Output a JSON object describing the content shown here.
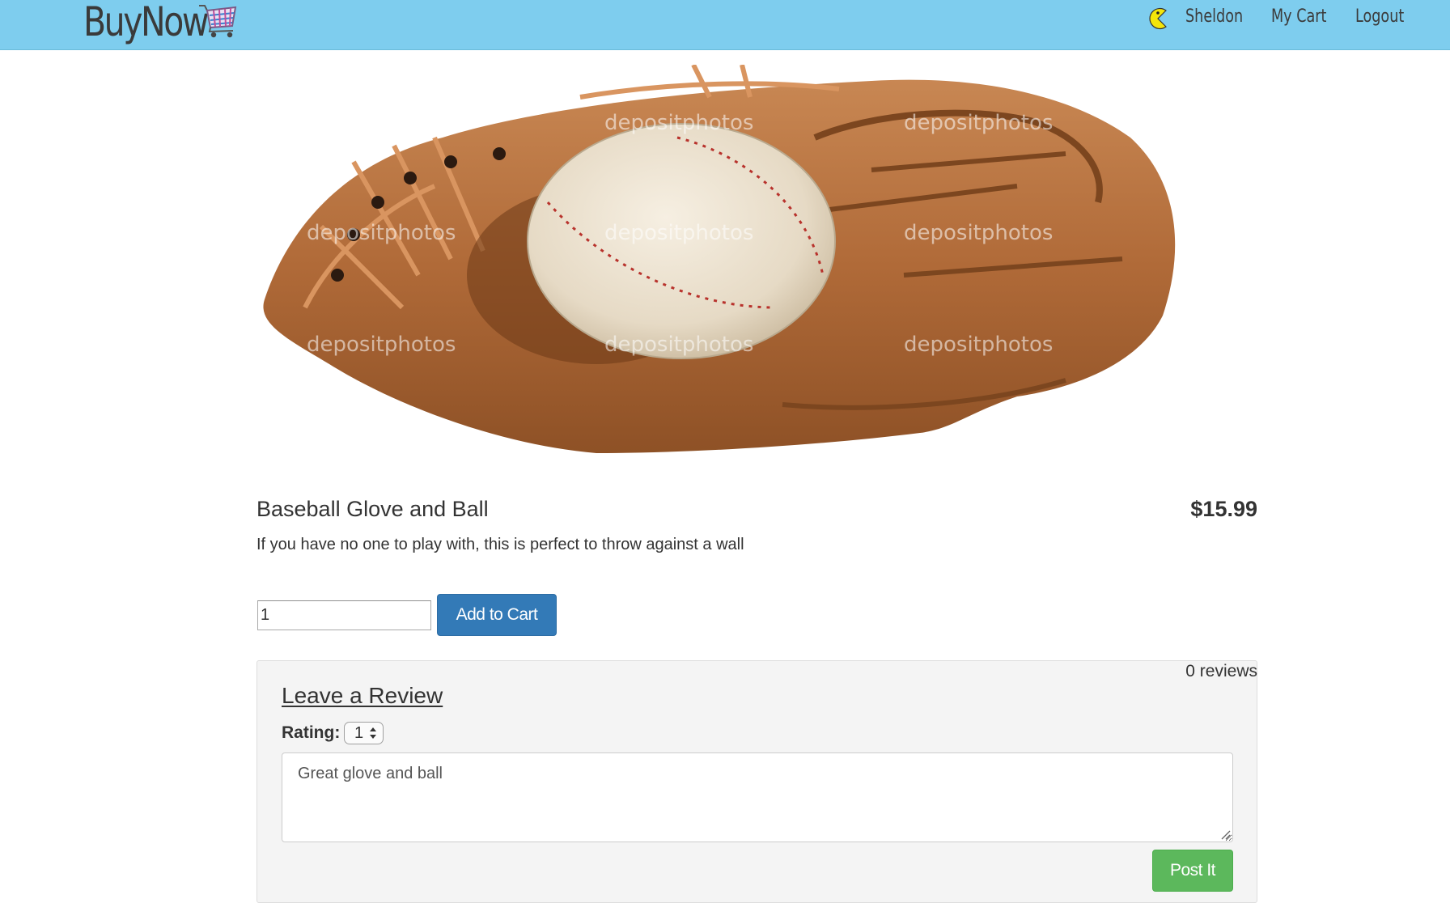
{
  "navbar": {
    "brand": "BuyNow",
    "brand_icon": "shopping-cart-icon",
    "user_icon": "pacman-icon",
    "user_name": "Sheldon",
    "cart_link": "My Cart",
    "logout_link": "Logout",
    "background_color": "#7ecdee"
  },
  "product": {
    "image": "baseball-glove-and-ball-photo",
    "watermark": "depositphotos",
    "title": "Baseball Glove and Ball",
    "price": "$15.99",
    "description": "If you have no one to play with, this is perfect to throw against a wall",
    "quantity_value": "1",
    "add_to_cart_label": "Add to Cart"
  },
  "review": {
    "count_text": "0 reviews",
    "heading": "Leave a Review",
    "rating_label": "Rating:",
    "rating_value": "1",
    "text_value": "Great glove and ball",
    "post_label": "Post It"
  },
  "colors": {
    "primary_button": "#337ab7",
    "success_button": "#5cb85c",
    "panel_background": "#f4f4f4"
  }
}
